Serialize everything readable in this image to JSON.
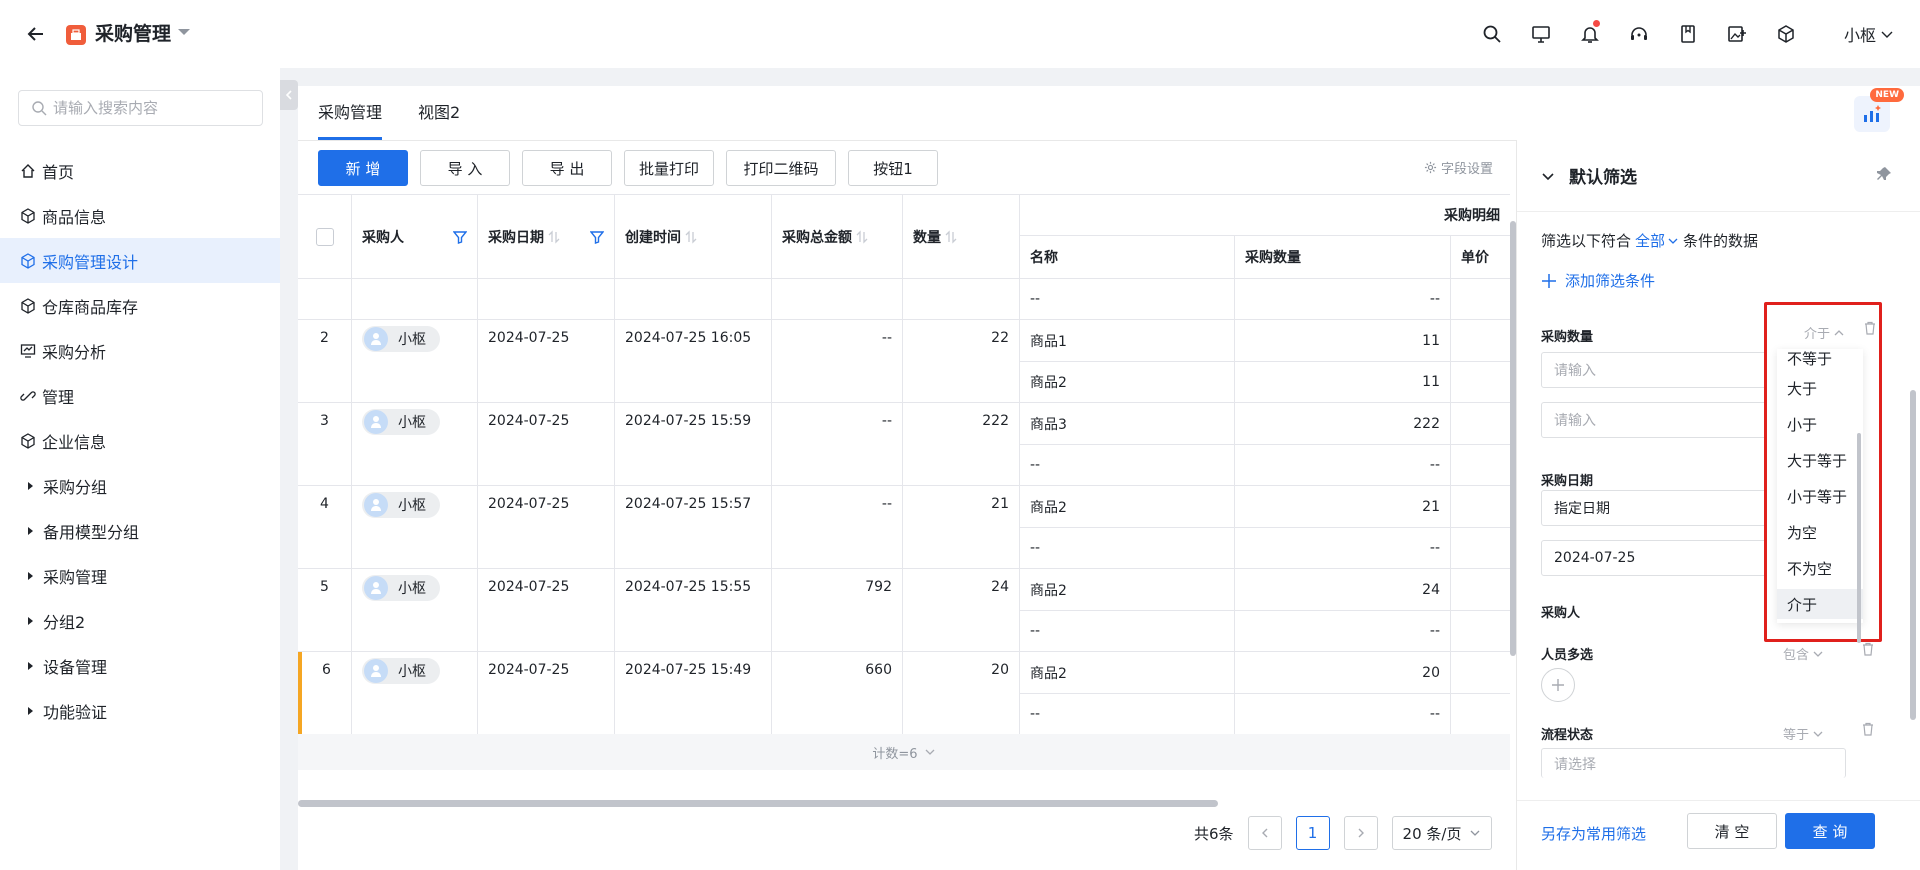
{
  "header": {
    "title": "采购管理",
    "user": "小枢"
  },
  "sidebar": {
    "search_placeholder": "请输入搜索内容",
    "items": [
      {
        "label": "首页",
        "icon": "home-icon"
      },
      {
        "label": "商品信息",
        "icon": "cube-icon"
      },
      {
        "label": "采购管理设计",
        "icon": "cube-icon",
        "active": true
      },
      {
        "label": "仓库商品库存",
        "icon": "cube-icon"
      },
      {
        "label": "采购分析",
        "icon": "chart-icon"
      },
      {
        "label": "管理",
        "icon": "link-icon"
      },
      {
        "label": "企业信息",
        "icon": "cube-icon"
      }
    ],
    "groups": [
      "采购分组",
      "备用模型分组",
      "采购管理",
      "分组2",
      "设备管理",
      "功能验证"
    ]
  },
  "tabs": [
    "采购管理",
    "视图2"
  ],
  "toolbar": {
    "buttons": [
      "新 增",
      "导 入",
      "导 出",
      "批量打印",
      "打印二维码",
      "按钮1"
    ],
    "field_settings": "字段设置"
  },
  "table": {
    "group_header": "采购明细",
    "headers": {
      "buyer": "采购人",
      "date": "采购日期",
      "created": "创建时间",
      "total": "采购总金额",
      "qty": "数量",
      "name": "名称",
      "pqty": "采购数量",
      "price": "单价"
    },
    "rows": [
      {
        "idx": "",
        "buyer": "",
        "date": "",
        "created": "",
        "total": "",
        "qty": "",
        "details": [
          {
            "name": "--",
            "qty": "--"
          }
        ]
      },
      {
        "idx": "2",
        "buyer": "小枢",
        "date": "2024-07-25",
        "created": "2024-07-25 16:05",
        "total": "--",
        "qty": "22",
        "details": [
          {
            "name": "商品1",
            "qty": "11"
          },
          {
            "name": "商品2",
            "qty": "11"
          }
        ]
      },
      {
        "idx": "3",
        "buyer": "小枢",
        "date": "2024-07-25",
        "created": "2024-07-25 15:59",
        "total": "--",
        "qty": "222",
        "details": [
          {
            "name": "商品3",
            "qty": "222"
          },
          {
            "name": "--",
            "qty": "--"
          }
        ]
      },
      {
        "idx": "4",
        "buyer": "小枢",
        "date": "2024-07-25",
        "created": "2024-07-25 15:57",
        "total": "--",
        "qty": "21",
        "details": [
          {
            "name": "商品2",
            "qty": "21"
          },
          {
            "name": "--",
            "qty": "--"
          }
        ]
      },
      {
        "idx": "5",
        "buyer": "小枢",
        "date": "2024-07-25",
        "created": "2024-07-25 15:55",
        "total": "792",
        "qty": "24",
        "details": [
          {
            "name": "商品2",
            "qty": "24"
          },
          {
            "name": "--",
            "qty": "--"
          }
        ]
      },
      {
        "idx": "6",
        "buyer": "小枢",
        "date": "2024-07-25",
        "created": "2024-07-25 15:49",
        "total": "660",
        "qty": "20",
        "details": [
          {
            "name": "商品2",
            "qty": "20"
          },
          {
            "name": "--",
            "qty": "--"
          }
        ]
      }
    ],
    "footer_count": "计数=6",
    "accent_color": "#f5a623"
  },
  "pager": {
    "total": "共6条",
    "page": "1",
    "size": "20 条/页"
  },
  "filter": {
    "title": "默认筛选",
    "desc_prefix": "筛选以下符合",
    "desc_select": "全部",
    "desc_suffix": "条件的数据",
    "add": "添加筛选条件",
    "fields": {
      "qty": {
        "label": "采购数量",
        "op": "介于",
        "ph1": "请输入",
        "ph2": "请输入"
      },
      "date": {
        "label": "采购日期",
        "mode": "指定日期",
        "value": "2024-07-25"
      },
      "buyer": {
        "label": "采购人"
      },
      "multi": {
        "label": "人员多选",
        "op": "包含"
      },
      "status": {
        "label": "流程状态",
        "op": "等于",
        "ph": "请选择"
      }
    },
    "save_as": "另存为常用筛选",
    "clear": "清 空",
    "query": "查 询"
  },
  "dropdown": {
    "current": "介于",
    "options": [
      "不等于",
      "大于",
      "小于",
      "大于等于",
      "小于等于",
      "为空",
      "不为空",
      "介于"
    ],
    "selected_index": 7
  },
  "colors": {
    "primary": "#1f6fe8",
    "highlight_border": "#e0201c"
  }
}
